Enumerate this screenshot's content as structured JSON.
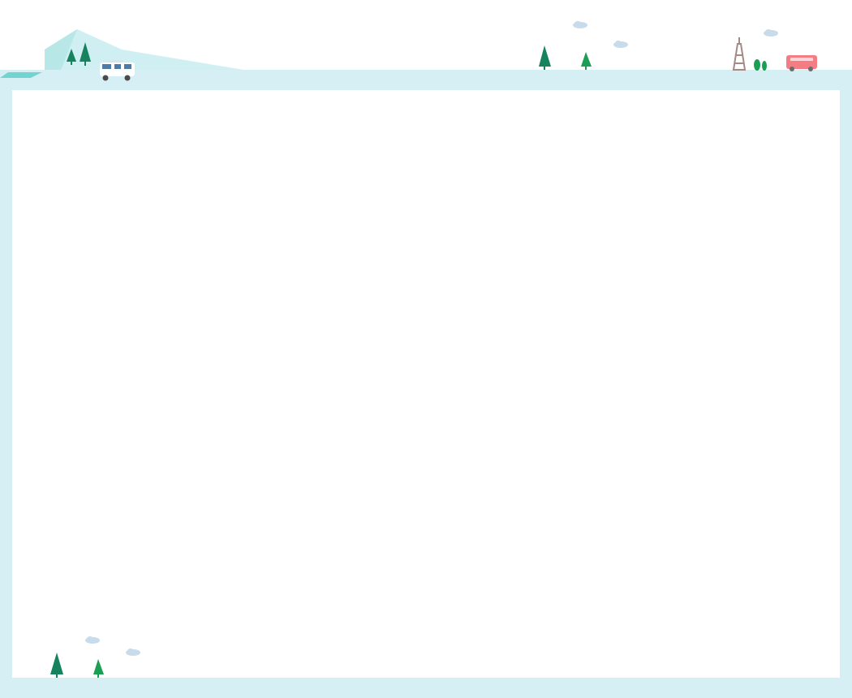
{
  "colors": {
    "frame": "#d6eff4",
    "panel": "#ffffff",
    "mountain_light": "#cfeff2",
    "mountain_mid": "#b7e7e6",
    "ground_teal": "#71d4d0",
    "tree_dark": "#16835e",
    "tree_green": "#1d9e55",
    "cloud": "#c8dbea",
    "tower": "#a48984",
    "bus": "#f47d84",
    "rv_body": "#ffffff",
    "rv_window": "#4f7ca7"
  },
  "icons": {
    "mountain": "mountain-icon",
    "tree": "tree-icon",
    "rv": "rv-icon",
    "cloud": "cloud-icon",
    "tower": "eiffel-tower-icon",
    "bus": "bus-icon"
  }
}
